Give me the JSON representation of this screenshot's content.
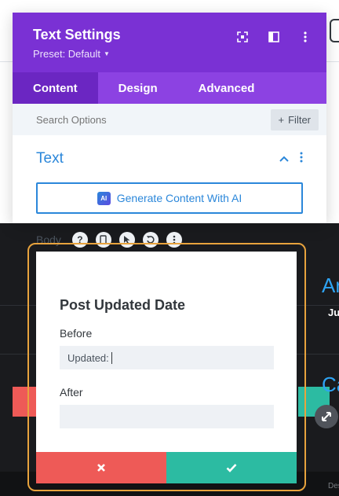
{
  "modal": {
    "title": "Text Settings",
    "preset": "Preset: Default",
    "tabs": [
      {
        "label": "Content",
        "active": true
      },
      {
        "label": "Design",
        "active": false
      },
      {
        "label": "Advanced",
        "active": false
      }
    ],
    "search_placeholder": "Search Options",
    "filter_label": "Filter",
    "section_title": "Text",
    "ai_button_label": "Generate Content With AI",
    "ai_badge": "AI",
    "body_label": "Body"
  },
  "popup": {
    "title": "Post Updated Date",
    "before_label": "Before",
    "before_value": "Updated:",
    "after_label": "After",
    "after_value": ""
  },
  "background": {
    "cyan_a": "Ar",
    "cyan_c": "Ca",
    "small_ju": "Ju",
    "small_des": "Des"
  },
  "colors": {
    "header_purple": "#7a31d4",
    "tab_purple": "#8c42e2",
    "accent_blue": "#2b87da",
    "cancel_red": "#ee5a57",
    "save_teal": "#2cbba2",
    "highlight_orange": "#e8a33d"
  }
}
